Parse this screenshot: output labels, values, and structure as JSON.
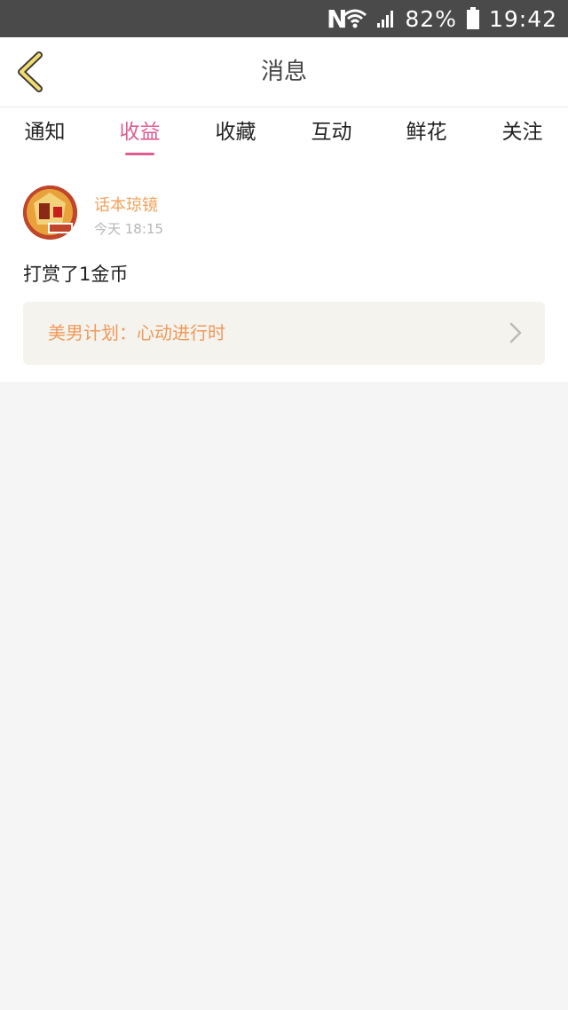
{
  "status_bar": {
    "notification_letter": "N",
    "battery": "82%",
    "time": "19:42",
    "icons": [
      "n-notification-icon",
      "wifi-icon",
      "signal-icon",
      "battery-icon"
    ]
  },
  "header": {
    "title": "消息",
    "back_icon": "back-chevron-icon",
    "accent": "#e05c91"
  },
  "tabs": [
    {
      "label": "通知",
      "active": false
    },
    {
      "label": "收益",
      "active": true
    },
    {
      "label": "收藏",
      "active": false
    },
    {
      "label": "互动",
      "active": false
    },
    {
      "label": "鲜花",
      "active": false
    },
    {
      "label": "关注",
      "active": false
    }
  ],
  "message": {
    "username": "话本琼镜",
    "time": "今天 18:15",
    "text": "打赏了1金币",
    "card_title": "美男计划：心动进行时",
    "username_color": "#f1a15b",
    "card_color": "#f09a5a"
  }
}
